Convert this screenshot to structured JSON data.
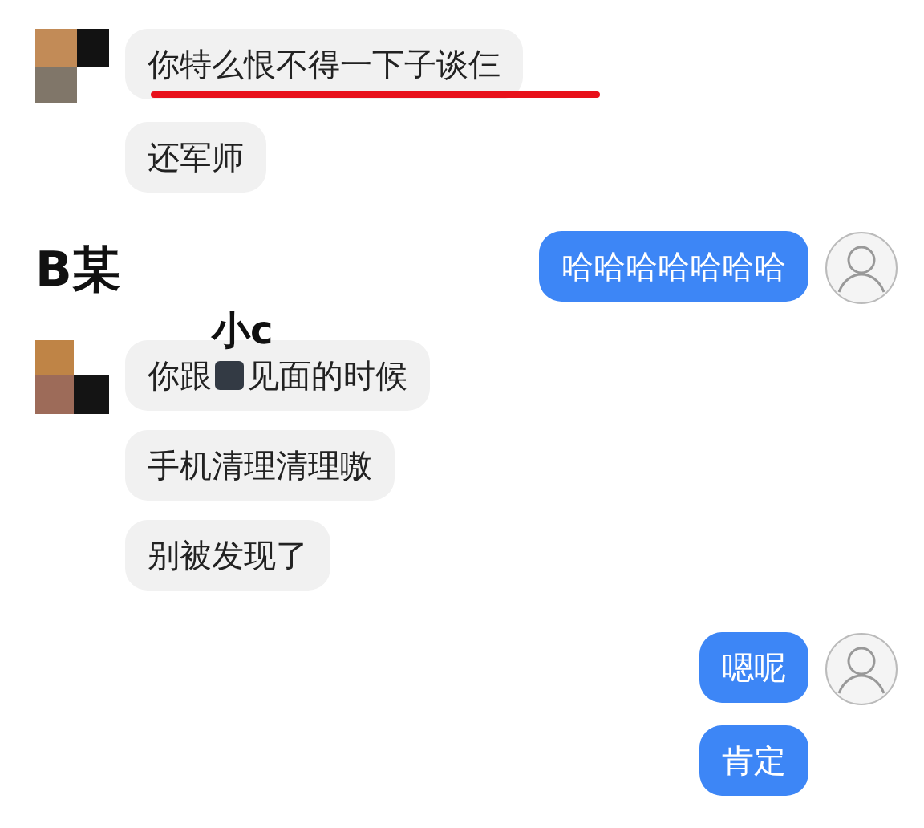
{
  "rows": [
    {
      "kind": "incoming",
      "avatar": true,
      "underlined": true,
      "parts": [
        {
          "kind": "text",
          "text": "你特么恨不得一下子谈仨"
        }
      ]
    },
    {
      "kind": "incoming",
      "avatar": false,
      "underlined": false,
      "parts": [
        {
          "kind": "text",
          "text": "还军师"
        }
      ]
    },
    {
      "kind": "outgoing",
      "avatar": true,
      "underlined": false,
      "note": "B某",
      "parts": [
        {
          "kind": "text",
          "text": "哈哈哈哈哈哈哈"
        }
      ]
    },
    {
      "kind": "incoming",
      "avatar": true,
      "underlined": false,
      "note": "小c",
      "parts": [
        {
          "kind": "text",
          "text": "你跟"
        },
        {
          "kind": "redaction"
        },
        {
          "kind": "text",
          "text": "见面的时候"
        }
      ]
    },
    {
      "kind": "incoming",
      "avatar": false,
      "underlined": false,
      "parts": [
        {
          "kind": "text",
          "text": "手机清理清理嗷"
        }
      ]
    },
    {
      "kind": "incoming",
      "avatar": false,
      "underlined": false,
      "parts": [
        {
          "kind": "text",
          "text": "别被发现了"
        }
      ]
    },
    {
      "kind": "outgoing",
      "avatar": true,
      "underlined": false,
      "parts": [
        {
          "kind": "text",
          "text": "嗯呢"
        }
      ]
    },
    {
      "kind": "outgoing",
      "avatar": false,
      "underlined": false,
      "parts": [
        {
          "kind": "text",
          "text": "肯定"
        }
      ]
    }
  ]
}
